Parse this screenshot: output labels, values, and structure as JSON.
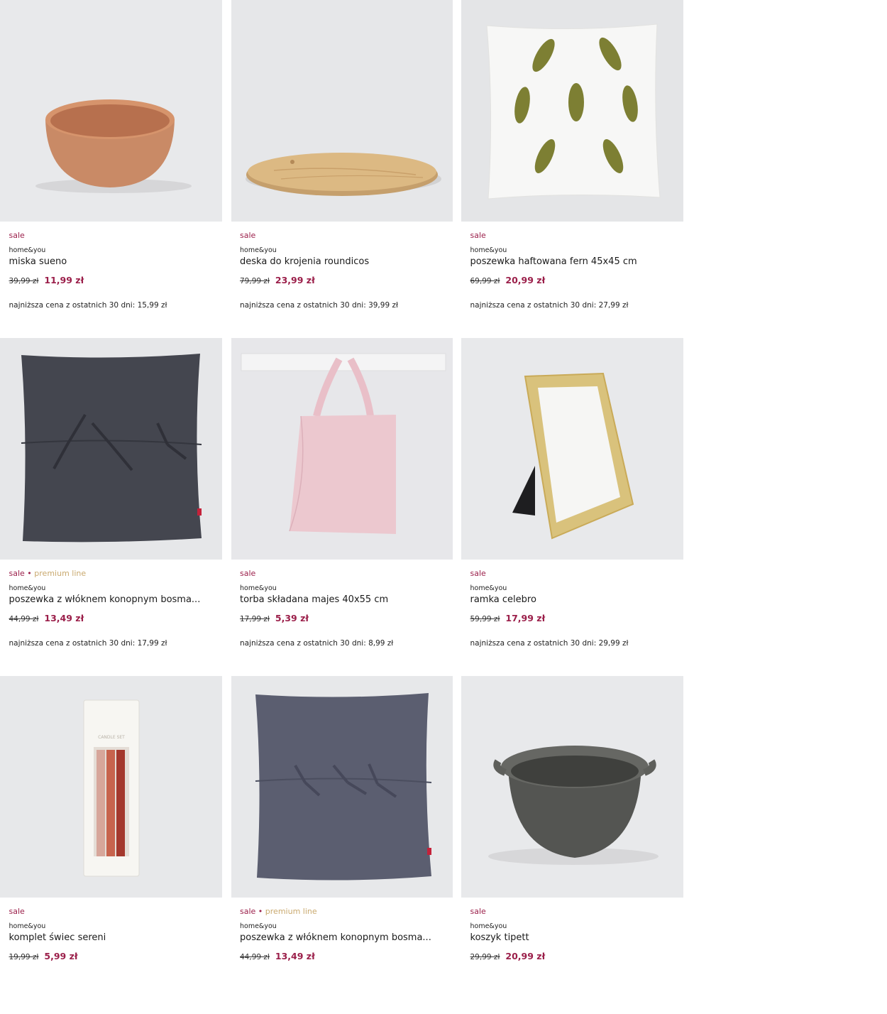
{
  "products": [
    {
      "tag_sale": "sale",
      "tag_premium": "",
      "brand": "home&you",
      "name": "miska sueno",
      "old_price": "39,99 zł",
      "new_price": "11,99 zł",
      "lowest": "najniższa cena z ostatnich 30 dni: 15,99 zł",
      "image": "terracotta-bowl"
    },
    {
      "tag_sale": "sale",
      "tag_premium": "",
      "brand": "home&you",
      "name": "deska do krojenia roundicos",
      "old_price": "79,99 zł",
      "new_price": "23,99 zł",
      "lowest": "najniższa cena z ostatnich 30 dni: 39,99 zł",
      "image": "wooden-cutting-board"
    },
    {
      "tag_sale": "sale",
      "tag_premium": "",
      "brand": "home&you",
      "name": "poszewka haftowana fern 45x45 cm",
      "old_price": "69,99 zł",
      "new_price": "20,99 zł",
      "lowest": "najniższa cena z ostatnich 30 dni: 27,99 zł",
      "image": "fern-embroidered-pillow"
    },
    {
      "tag_sale": "sale",
      "tag_premium": "premium line",
      "brand": "home&you",
      "name": "poszewka z włóknem konopnym bosma...",
      "old_price": "44,99 zł",
      "new_price": "13,49 zł",
      "lowest": "najniższa cena z ostatnich 30 dni: 17,99 zł",
      "image": "dark-grey-pillow"
    },
    {
      "tag_sale": "sale",
      "tag_premium": "",
      "brand": "home&you",
      "name": "torba składana majes 40x55 cm",
      "old_price": "17,99 zł",
      "new_price": "5,39 zł",
      "lowest": "najniższa cena z ostatnich 30 dni: 8,99 zł",
      "image": "pink-tote-bag"
    },
    {
      "tag_sale": "sale",
      "tag_premium": "",
      "brand": "home&you",
      "name": "ramka celebro",
      "old_price": "59,99 zł",
      "new_price": "17,99 zł",
      "lowest": "najniższa cena z ostatnich 30 dni: 29,99 zł",
      "image": "gold-photo-frame"
    },
    {
      "tag_sale": "sale",
      "tag_premium": "",
      "brand": "home&you",
      "name": "komplet świec sereni",
      "old_price": "19,99 zł",
      "new_price": "5,99 zł",
      "lowest": "",
      "image": "candle-set-box"
    },
    {
      "tag_sale": "sale",
      "tag_premium": "premium line",
      "brand": "home&you",
      "name": "poszewka z włóknem konopnym bosma...",
      "old_price": "44,99 zł",
      "new_price": "13,49 zł",
      "lowest": "",
      "image": "grey-blue-pillow"
    },
    {
      "tag_sale": "sale",
      "tag_premium": "",
      "brand": "home&you",
      "name": "koszyk tipett",
      "old_price": "29,99 zł",
      "new_price": "20,99 zł",
      "lowest": "",
      "image": "grey-rope-basket"
    }
  ],
  "box_text": {
    "candle_label": "CANDLE SET"
  },
  "separator": "•",
  "colors": {
    "sale": "#9b1f4a",
    "premium": "#c9a96e",
    "image_bg": "#e9eaec"
  }
}
